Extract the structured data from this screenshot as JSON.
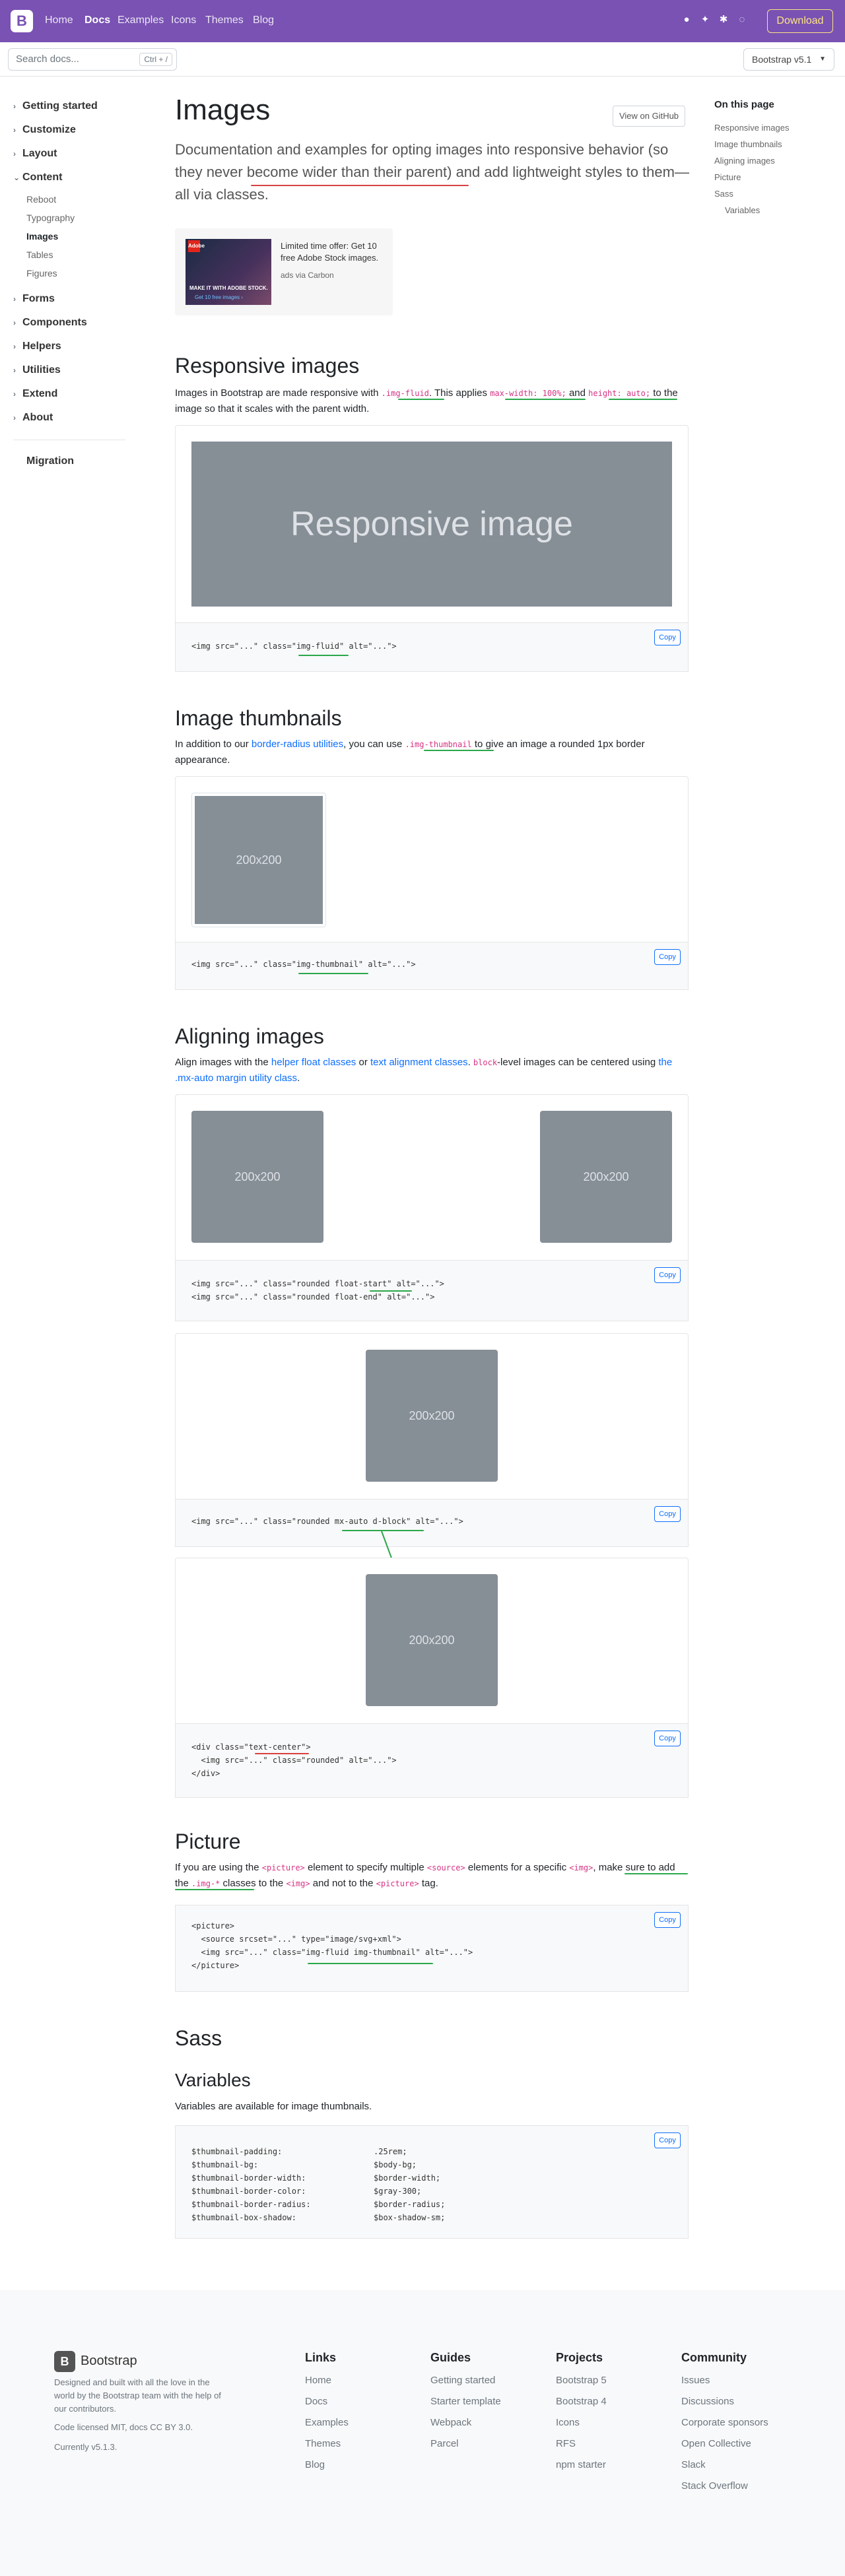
{
  "nav": {
    "brand": "B",
    "links": [
      "Home",
      "Docs",
      "Examples",
      "Icons",
      "Themes",
      "Blog"
    ],
    "download": "Download",
    "icons": [
      "github-icon",
      "twitter-icon",
      "slack-icon",
      "opencollective-icon"
    ]
  },
  "subnav": {
    "search_placeholder": "Search docs...",
    "shortcut": "Ctrl + /",
    "version": "Bootstrap v5.1"
  },
  "sidebar": {
    "groups": [
      "Getting started",
      "Customize",
      "Layout",
      "Content",
      "Forms",
      "Components",
      "Helpers",
      "Utilities",
      "Extend",
      "About"
    ],
    "content_items": [
      "Reboot",
      "Typography",
      "Images",
      "Tables",
      "Figures"
    ],
    "migration": "Migration"
  },
  "page": {
    "title": "Images",
    "lead": "Documentation and examples for opting images into responsive behavior (so they never become wider than their parent) and add lightweight styles to them—all via classes.",
    "view_github": "View on GitHub"
  },
  "carbon": {
    "text": "Limited time offer: Get 10 free Adobe Stock images.",
    "by": "ads via Carbon",
    "logo": "Adobe",
    "img_line1": "MAKE IT WITH ADOBE STOCK.",
    "img_line2": "Get 10 free images ›"
  },
  "toc": {
    "title": "On this page",
    "items": [
      "Responsive images",
      "Image thumbnails",
      "Aligning images",
      "Picture",
      "Sass"
    ],
    "subitems": [
      "Variables"
    ]
  },
  "responsive": {
    "heading": "Responsive images",
    "p1": "Images in Bootstrap are made responsive with ",
    "c1": ".img-fluid",
    "p2": ". This applies ",
    "c2": "max-width: 100%;",
    "p3": " and ",
    "c3": "height: auto;",
    "p4": " to the image so that it scales with the parent width.",
    "placeholder": "Responsive image",
    "code": [
      "<img src=\"...\" class=\"img-fluid\" alt=\"...\">"
    ]
  },
  "thumbnails": {
    "heading": "Image thumbnails",
    "p1": "In addition to our ",
    "link": "border-radius utilities",
    "p2": ", you can use ",
    "c1": ".img-thumbnail",
    "p3": " to give an image a rounded 1px border appearance.",
    "placeholder": "200x200",
    "code": [
      "<img src=\"...\" class=\"img-thumbnail\" alt=\"...\">"
    ]
  },
  "aligning": {
    "heading": "Aligning images",
    "p1": "Align images with the ",
    "link1": "helper float classes",
    "p2": " or ",
    "link2": "text alignment classes",
    "p3": ". ",
    "c1": "block",
    "p4": "-level images can be centered using ",
    "link3": "the .mx-auto margin utility class",
    "p5": ".",
    "placeholder": "200x200",
    "code1": [
      "<img src=\"...\" class=\"rounded float-start\" alt=\"...\">",
      "<img src=\"...\" class=\"rounded float-end\" alt=\"...\">"
    ],
    "code2": [
      "<img src=\"...\" class=\"rounded mx-auto d-block\" alt=\"...\">"
    ],
    "code3": [
      "<div class=\"text-center\">",
      "  <img src=\"...\" class=\"rounded\" alt=\"...\">",
      "</div>"
    ]
  },
  "picture": {
    "heading": "Picture",
    "p1": "If you are using the ",
    "c1": "<picture>",
    "p2": " element to specify multiple ",
    "c2": "<source>",
    "p3": " elements for a specific ",
    "c3": "<img>",
    "p4": ", make sure to add the ",
    "c4": ".img-*",
    "p5": " classes to the ",
    "c5": "<img>",
    "p6": " and not to the ",
    "c6": "<picture>",
    "p7": " tag.",
    "code": [
      "<picture>",
      "  <source srcset=\"...\" type=\"image/svg+xml\">",
      "  <img src=\"...\" class=\"img-fluid img-thumbnail\" alt=\"...\">",
      "</picture>"
    ]
  },
  "sass": {
    "heading": "Sass",
    "variables_heading": "Variables",
    "p": "Variables are available for image thumbnails.",
    "vars": [
      {
        "name": "$thumbnail-padding:",
        "value": ".25rem;"
      },
      {
        "name": "$thumbnail-bg:",
        "value": "$body-bg;"
      },
      {
        "name": "$thumbnail-border-width:",
        "value": "$border-width;"
      },
      {
        "name": "$thumbnail-border-color:",
        "value": "$gray-300;"
      },
      {
        "name": "$thumbnail-border-radius:",
        "value": "$border-radius;"
      },
      {
        "name": "$thumbnail-box-shadow:",
        "value": "$box-shadow-sm;"
      }
    ]
  },
  "copy_label": "Copy",
  "footer": {
    "brand": "Bootstrap",
    "desc": "Designed and built with all the love in the world by the Bootstrap team with the help of our contributors.",
    "license": "Code licensed MIT, docs CC BY 3.0.",
    "current": "Currently v5.1.3.",
    "columns": [
      {
        "title": "Links",
        "items": [
          "Home",
          "Docs",
          "Examples",
          "Themes",
          "Blog"
        ]
      },
      {
        "title": "Guides",
        "items": [
          "Getting started",
          "Starter template",
          "Webpack",
          "Parcel"
        ]
      },
      {
        "title": "Projects",
        "items": [
          "Bootstrap 5",
          "Bootstrap 4",
          "Icons",
          "RFS",
          "npm starter"
        ]
      },
      {
        "title": "Community",
        "items": [
          "Issues",
          "Discussions",
          "Corporate sponsors",
          "Open Collective",
          "Slack",
          "Stack Overflow"
        ]
      }
    ]
  }
}
